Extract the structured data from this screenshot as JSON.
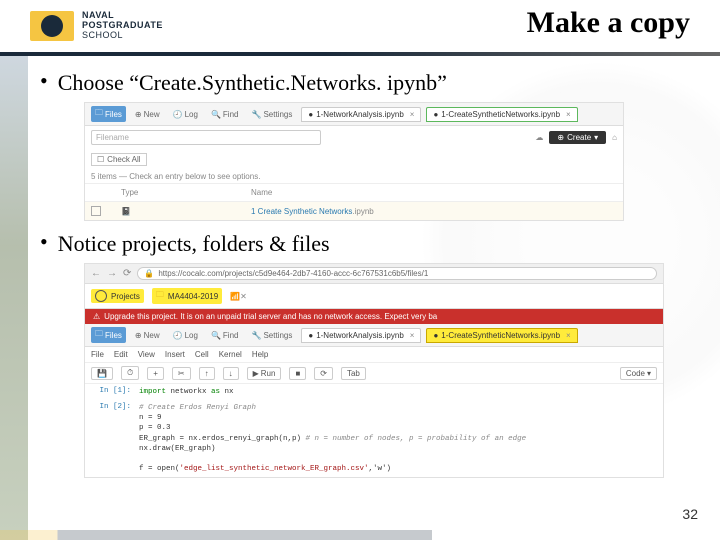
{
  "header": {
    "institution_line1": "NAVAL",
    "institution_line2": "POSTGRADUATE",
    "institution_line3": "SCHOOL",
    "title": "Make a copy"
  },
  "bullets": {
    "b1": "Choose “Create.Synthetic.Networks. ipynb”",
    "b2": "Notice projects, folders & files"
  },
  "ss1": {
    "toolbar": {
      "files": "Files",
      "new": "New",
      "log": "Log",
      "find": "Find",
      "settings": "Settings",
      "tab1": "1-NetworkAnalysis.ipynb",
      "tab2": "1-CreateSyntheticNetworks.ipynb"
    },
    "filename_placeholder": "Filename",
    "create_label": "Create",
    "checkall": "Check All",
    "hint": "5 items — Check an entry below to see options.",
    "col_type": "Type",
    "col_name": "Name",
    "file_name": "1 Create Synthetic Networks",
    "file_ext": ".ipynb"
  },
  "ss2": {
    "url": "https://cocalc.com/projects/c5d9e464-2db7-4160-accc-6c767531c6b5/files/1",
    "projects": "Projects",
    "project_name": "MA4404-2019",
    "warning": "Upgrade this project. It is on an unpaid trial server and has no network access. Expect very ba",
    "tab_hl": "1-CreateSyntheticNetworks.ipynb",
    "menu": {
      "file": "File",
      "edit": "Edit",
      "view": "View",
      "insert": "Insert",
      "cell": "Cell",
      "kernel": "Kernel",
      "help": "Help"
    },
    "actions": {
      "run": "Run",
      "stop": "",
      "restart": "",
      "tab": "Tab",
      "code": "Code"
    },
    "cell1_prompt": "In [1]:",
    "cell1_code": "import networkx as nx",
    "cell2_prompt": "In [2]:",
    "cell2_line1": "# Create Erdos Renyi Graph",
    "cell2_line2": "n = 9",
    "cell2_line3": "p = 0.3",
    "cell2_line4": "ER_graph = nx.erdos_renyi_graph(n,p)",
    "cell2_line4_comment": " # n = number of nodes, p = probability of an edge",
    "cell2_line5": "nx.draw(ER_graph)",
    "cell2_line6a": "f = open(",
    "cell2_line6b": "'edge_list_synthetic_network_ER_graph.csv'",
    "cell2_line6c": ",'w')"
  },
  "page_number": "32"
}
